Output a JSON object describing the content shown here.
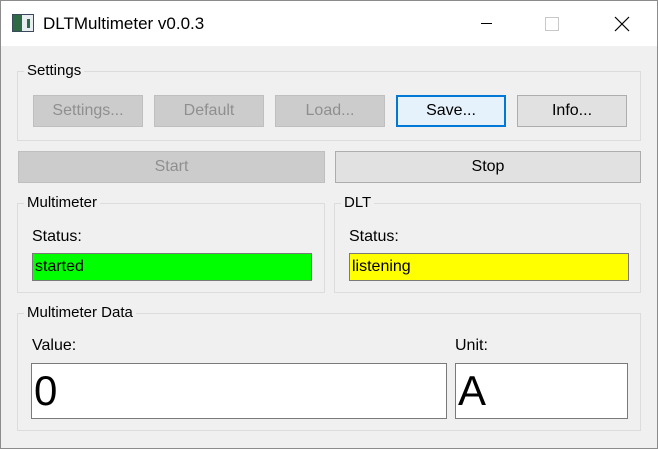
{
  "window": {
    "title": "DLTMultimeter v0.0.3"
  },
  "settings_group": {
    "title": "Settings",
    "buttons": {
      "settings": "Settings...",
      "default": "Default",
      "load": "Load...",
      "save": "Save...",
      "info": "Info..."
    }
  },
  "controls": {
    "start": "Start",
    "stop": "Stop"
  },
  "multimeter_group": {
    "title": "Multimeter",
    "status_label": "Status:",
    "status_value": "started",
    "status_color": "#00ff00"
  },
  "dlt_group": {
    "title": "DLT",
    "status_label": "Status:",
    "status_value": "listening",
    "status_color": "#ffff00"
  },
  "data_group": {
    "title": "Multimeter Data",
    "value_label": "Value:",
    "value": "0",
    "unit_label": "Unit:",
    "unit": "A"
  },
  "icons": {
    "app": "multimeter-app-icon",
    "minimize": "minimize-icon",
    "maximize": "maximize-icon",
    "close": "close-icon"
  }
}
